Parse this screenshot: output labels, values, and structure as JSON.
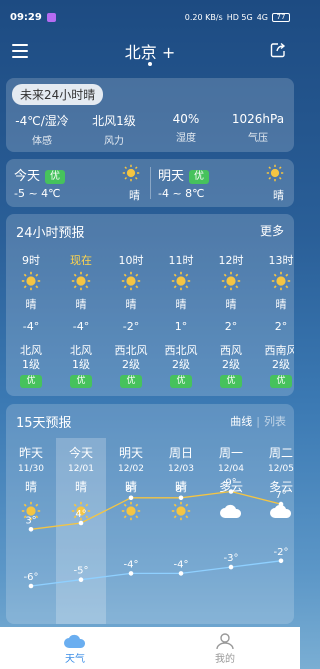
{
  "status_bar": {
    "time": "09:29",
    "speed": "0.20 KB/s",
    "network": "HD 5G",
    "signal": "4G",
    "battery": "77"
  },
  "header": {
    "city": "北京 +"
  },
  "now": {
    "title": "未来24小时晴",
    "stats": [
      {
        "value": "-4℃/湿冷",
        "label": "体感"
      },
      {
        "value": "北风1级",
        "label": "风力"
      },
      {
        "value": "40%",
        "label": "湿度"
      },
      {
        "value": "1026hPa",
        "label": "气压"
      }
    ]
  },
  "days": {
    "today": {
      "name": "今天",
      "aqi": "优",
      "temps": "-5 ~ 4℃",
      "cond": "晴"
    },
    "tomorrow": {
      "name": "明天",
      "aqi": "优",
      "temps": "-4 ~ 8℃",
      "cond": "晴"
    }
  },
  "hourly": {
    "title": "24小时预报",
    "more": "更多",
    "hours": [
      {
        "time": "9时",
        "cond": "晴",
        "temp": "-4°",
        "wind_dir": "北风",
        "wind_lvl": "1级",
        "aqi": "优",
        "icon": "sun-icon",
        "now": false
      },
      {
        "time": "现在",
        "cond": "晴",
        "temp": "-4°",
        "wind_dir": "北风",
        "wind_lvl": "1级",
        "aqi": "优",
        "icon": "sun-icon",
        "now": true
      },
      {
        "time": "10时",
        "cond": "晴",
        "temp": "-2°",
        "wind_dir": "西北风",
        "wind_lvl": "2级",
        "aqi": "优",
        "icon": "sun-icon",
        "now": false
      },
      {
        "time": "11时",
        "cond": "晴",
        "temp": "1°",
        "wind_dir": "西北风",
        "wind_lvl": "2级",
        "aqi": "优",
        "icon": "sun-icon",
        "now": false
      },
      {
        "time": "12时",
        "cond": "晴",
        "temp": "2°",
        "wind_dir": "西风",
        "wind_lvl": "2级",
        "aqi": "优",
        "icon": "sun-icon",
        "now": false
      },
      {
        "time": "13时",
        "cond": "晴",
        "temp": "2°",
        "wind_dir": "西南风",
        "wind_lvl": "2级",
        "aqi": "优",
        "icon": "sun-icon",
        "now": false
      }
    ]
  },
  "forecast": {
    "title": "15天预报",
    "view_curve": "曲线",
    "view_list": "列表",
    "days": [
      {
        "day": "昨天",
        "date": "11/30",
        "cond": "晴",
        "icon": "sun-icon",
        "high": 3,
        "low": -6
      },
      {
        "day": "今天",
        "date": "12/01",
        "cond": "晴",
        "icon": "sun-icon",
        "high": 4,
        "low": -5
      },
      {
        "day": "明天",
        "date": "12/02",
        "cond": "晴",
        "icon": "sun-icon",
        "high": 8,
        "low": -4
      },
      {
        "day": "周日",
        "date": "12/03",
        "cond": "晴",
        "icon": "sun-icon",
        "high": 8,
        "low": -4
      },
      {
        "day": "周一",
        "date": "12/04",
        "cond": "多云",
        "icon": "cloud-icon",
        "high": 9,
        "low": -3
      },
      {
        "day": "周二",
        "date": "12/05",
        "cond": "多云",
        "icon": "cloud-icon",
        "high": 7,
        "low": -2
      }
    ]
  },
  "nav": {
    "weather": "天气",
    "mine": "我的"
  },
  "colors": {
    "accent": "#3c8ee6",
    "aqi_good": "#46c25c",
    "now_time": "#ffd44d",
    "high_line": "#f5c542",
    "low_line": "#8fd0ff"
  }
}
